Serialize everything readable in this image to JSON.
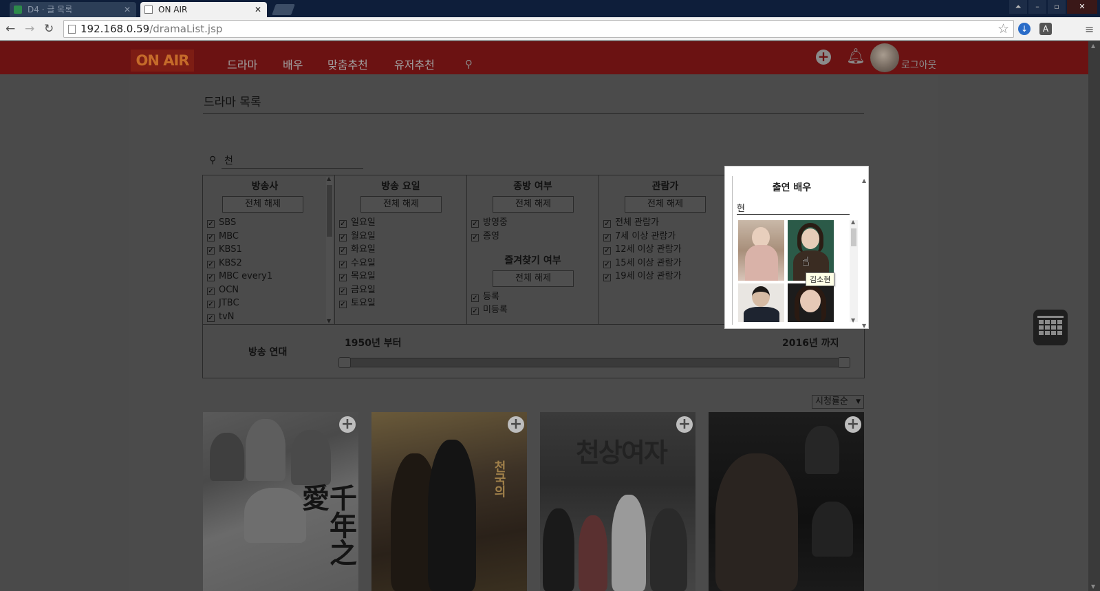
{
  "browser": {
    "tabs": [
      {
        "title": "D4 · 글 목록",
        "active": false
      },
      {
        "title": "ON AIR",
        "active": true
      }
    ],
    "url_host": "192.168.0.59",
    "url_path": "/dramaList.jsp",
    "tab_close": "✕"
  },
  "header": {
    "logo": "ON AIR",
    "nav": [
      "드라마",
      "배우",
      "맞춤추천",
      "유저추천"
    ],
    "logout": "로그아웃"
  },
  "page": {
    "title": "드라마 목록",
    "search_value": "천"
  },
  "filters": {
    "clear_label": "전체 해제",
    "broadcaster": {
      "heading": "방송사",
      "items": [
        "SBS",
        "MBC",
        "KBS1",
        "KBS2",
        "MBC every1",
        "OCN",
        "JTBC",
        "tvN"
      ]
    },
    "airday": {
      "heading": "방송 요일",
      "items": [
        "일요일",
        "월요일",
        "화요일",
        "수요일",
        "목요일",
        "금요일",
        "토요일"
      ]
    },
    "status": {
      "heading": "종방 여부",
      "items": [
        "방영중",
        "종영"
      ]
    },
    "favorite": {
      "heading": "즐겨찾기 여부",
      "items": [
        "등록",
        "미등록"
      ]
    },
    "rating": {
      "heading": "관람가",
      "items": [
        "전체 관람가",
        "7세 이상 관람가",
        "12세 이상 관람가",
        "15세 이상 관람가",
        "19세 이상 관람가"
      ]
    },
    "actor": {
      "heading": "출연 배우",
      "input_value": "현",
      "tooltip": "김소현"
    },
    "era": {
      "label": "방송 연대",
      "from": "1950년 부터",
      "to": "2016년 까지"
    }
  },
  "sort": {
    "selected": "시청률순"
  },
  "posters": [
    {
      "title_text": "千年之愛"
    },
    {
      "title_text": "천국의"
    },
    {
      "title_text": "천상여자"
    },
    {
      "title_text": ""
    }
  ],
  "colors": {
    "header_bg": "#6b1212",
    "overlay": "#4b4b4b",
    "highlight_panel": "#ffffff"
  }
}
